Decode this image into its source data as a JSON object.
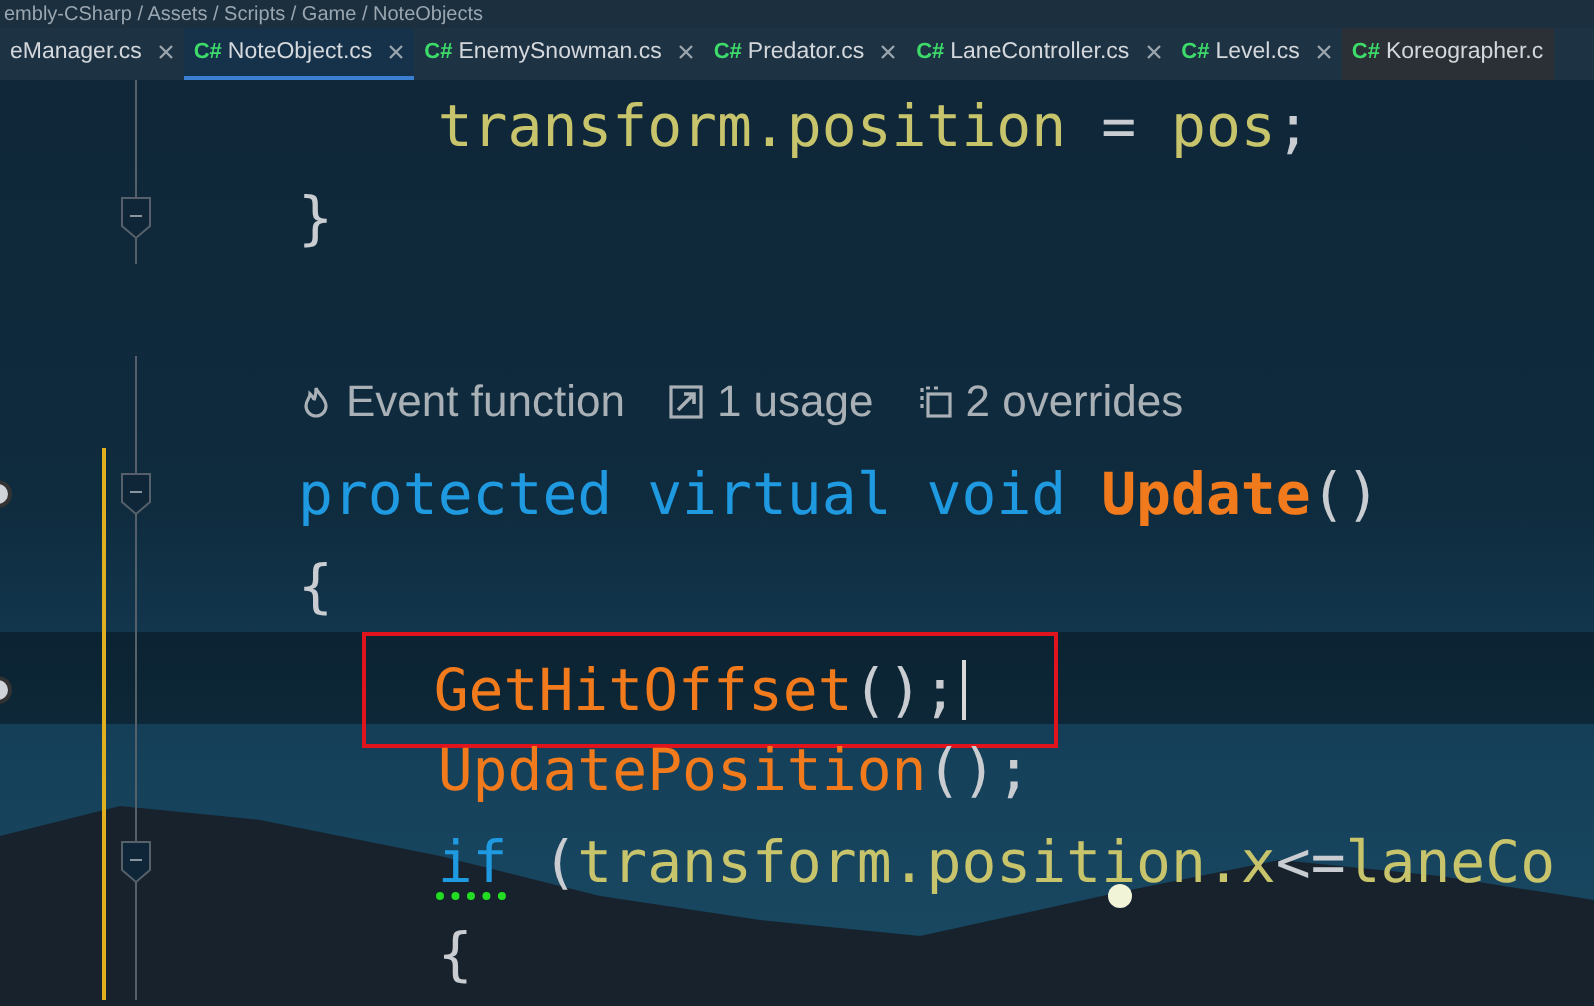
{
  "breadcrumb": "embly-CSharp / Assets / Scripts / Game / NoteObjects",
  "tabs": [
    {
      "label": "eManager.cs",
      "selected": false,
      "closable": true
    },
    {
      "label": "NoteObject.cs",
      "lang": "C#",
      "selected": true,
      "closable": true
    },
    {
      "label": "EnemySnowman.cs",
      "lang": "C#",
      "selected": false,
      "closable": true
    },
    {
      "label": "Predator.cs",
      "lang": "C#",
      "selected": false,
      "closable": true
    },
    {
      "label": "LaneController.cs",
      "lang": "C#",
      "selected": false,
      "closable": true
    },
    {
      "label": "Level.cs",
      "lang": "C#",
      "selected": false,
      "closable": true
    },
    {
      "label": "Koreographer.c",
      "lang": "C#",
      "selected": false,
      "closable": false
    }
  ],
  "lines": [
    {
      "kind": "block",
      "children": [
        {
          "kind": "code",
          "fold": false,
          "modified": false,
          "gutter_icon": false,
          "current": false,
          "caret": false,
          "boxed": false,
          "squiggle": false,
          "tokens": [
            {
              "text": "transform.position",
              "kind": "field"
            },
            {
              "text": " = ",
              "kind": "plain"
            },
            {
              "text": "pos",
              "kind": "field"
            },
            {
              "text": ";",
              "kind": "plain"
            }
          ]
        }
      ]
    },
    {
      "kind": "code",
      "fold": true,
      "modified": false,
      "gutter_icon": false,
      "current": false,
      "caret": false,
      "boxed": false,
      "squiggle": false,
      "tokens": [
        {
          "text": "}",
          "kind": "plain"
        }
      ]
    },
    {
      "kind": "blank"
    },
    {
      "kind": "hints",
      "hints": [
        {
          "text": "Event function"
        },
        {
          "text": "1 usage"
        },
        {
          "text": "2 overrides"
        }
      ]
    },
    {
      "kind": "code",
      "fold": true,
      "modified": true,
      "gutter_icon": true,
      "current": false,
      "caret": false,
      "boxed": false,
      "squiggle": false,
      "tokens": [
        {
          "text": "protected virtual void ",
          "kind": "keyword"
        },
        {
          "text": "Update",
          "kind": "method-bold"
        },
        {
          "text": "()",
          "kind": "plain"
        }
      ]
    },
    {
      "kind": "code",
      "fold": false,
      "modified": true,
      "gutter_icon": false,
      "current": false,
      "caret": false,
      "boxed": false,
      "squiggle": false,
      "tokens": [
        {
          "text": "{",
          "kind": "plain"
        }
      ]
    },
    {
      "kind": "block",
      "children": [
        {
          "kind": "code",
          "fold": false,
          "modified": true,
          "gutter_icon": true,
          "current": true,
          "caret": true,
          "boxed": true,
          "squiggle": false,
          "tokens": [
            {
              "text": "GetHitOffset",
              "kind": "method"
            },
            {
              "text": "();",
              "kind": "plain"
            }
          ]
        },
        {
          "kind": "code",
          "fold": false,
          "modified": true,
          "gutter_icon": false,
          "current": false,
          "caret": false,
          "boxed": false,
          "squiggle": false,
          "tokens": [
            {
              "text": "UpdatePosition",
              "kind": "method"
            },
            {
              "text": "();",
              "kind": "plain"
            }
          ]
        },
        {
          "kind": "code",
          "fold": true,
          "modified": true,
          "gutter_icon": false,
          "current": false,
          "caret": false,
          "boxed": false,
          "squiggle": true,
          "tokens": [
            {
              "text": "if",
              "kind": "keyword"
            },
            {
              "text": " (",
              "kind": "plain"
            },
            {
              "text": "transform.position.x",
              "kind": "field"
            },
            {
              "text": "<=",
              "kind": "plain"
            },
            {
              "text": "laneCo",
              "kind": "field"
            }
          ]
        },
        {
          "kind": "code",
          "fold": false,
          "modified": true,
          "gutter_icon": false,
          "current": false,
          "caret": false,
          "boxed": false,
          "squiggle": false,
          "tokens": [
            {
              "text": "{",
              "kind": "plain"
            }
          ]
        }
      ]
    }
  ]
}
